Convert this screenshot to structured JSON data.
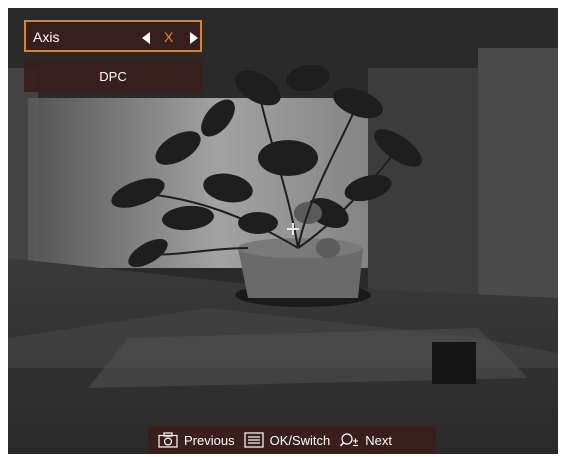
{
  "menu": {
    "axis": {
      "label": "Axis",
      "value": "X"
    },
    "dpc": {
      "label": "DPC"
    }
  },
  "hints": {
    "previous": {
      "icon": "camera-icon",
      "label": "Previous"
    },
    "ok_switch": {
      "icon": "menu-icon",
      "label": "OK/Switch"
    },
    "next": {
      "icon": "zoom-icon",
      "label": "Next"
    }
  },
  "colors": {
    "accent": "#e0892b",
    "menu_bg": "#3a1e1a",
    "text": "#ffffff"
  }
}
